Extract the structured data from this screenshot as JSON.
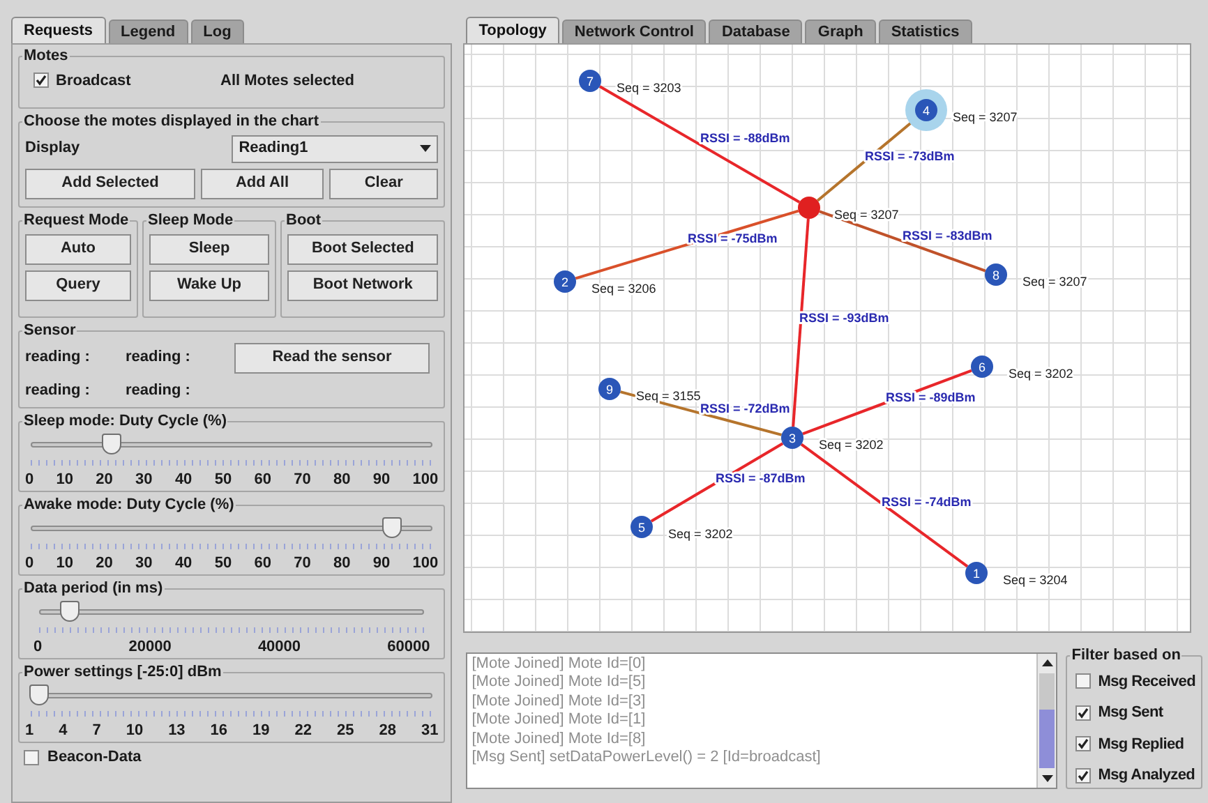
{
  "left_tabs": [
    {
      "label": "Requests",
      "selected": true
    },
    {
      "label": "Legend",
      "selected": false
    },
    {
      "label": "Log",
      "selected": false
    }
  ],
  "motes": {
    "title": "Motes",
    "broadcast": {
      "label": "Broadcast",
      "checked": true
    },
    "status": "All Motes selected"
  },
  "chart_motes": {
    "title": "Choose the motes displayed in the chart",
    "display_label": "Display",
    "display_value": "Reading1",
    "buttons": [
      "Add Selected",
      "Add All",
      "Clear"
    ]
  },
  "mode_groups": [
    {
      "title": "Request Mode",
      "buttons": [
        "Auto",
        "Query"
      ]
    },
    {
      "title": "Sleep Mode",
      "buttons": [
        "Sleep",
        "Wake Up"
      ]
    },
    {
      "title": "Boot",
      "buttons": [
        "Boot Selected",
        "Boot Network"
      ]
    }
  ],
  "sensor": {
    "title": "Sensor",
    "readings": [
      "reading :",
      "reading :",
      "reading :",
      "reading :"
    ],
    "button": "Read the sensor"
  },
  "sliders": [
    {
      "title": "Sleep mode: Duty Cycle (%)",
      "level": 0.2,
      "ticks": [
        "0",
        "10",
        "20",
        "30",
        "40",
        "50",
        "60",
        "70",
        "80",
        "90",
        "100"
      ]
    },
    {
      "title": "Awake mode: Duty Cycle (%)",
      "level": 0.9,
      "ticks": [
        "0",
        "10",
        "20",
        "30",
        "40",
        "50",
        "60",
        "70",
        "80",
        "90",
        "100"
      ]
    },
    {
      "title": "Data period (in ms)",
      "level": 0.08,
      "ticks": [
        "0",
        "20000",
        "40000",
        "60000"
      ]
    },
    {
      "title": "Power settings [-25:0] dBm",
      "level": 0.02,
      "ticks": [
        "1",
        "4",
        "7",
        "10",
        "13",
        "16",
        "19",
        "22",
        "25",
        "28",
        "31"
      ]
    }
  ],
  "beacon": {
    "label": "Beacon-Data",
    "checked": false
  },
  "right_tabs": [
    {
      "label": "Topology",
      "selected": true
    },
    {
      "label": "Network Control",
      "selected": false
    },
    {
      "label": "Database",
      "selected": false
    },
    {
      "label": "Graph",
      "selected": false
    },
    {
      "label": "Statistics",
      "selected": false
    }
  ],
  "topology": {
    "root": {
      "kind": "gateway",
      "seq": "Seq = 3207",
      "selected": false,
      "children": [
        {
          "kind": "mote",
          "label": "7",
          "seq": "Seq = 3203",
          "selected": false,
          "rssi": "RSSI = -88dBm",
          "color": "#e8262a"
        },
        {
          "kind": "mote",
          "label": "4",
          "seq": "Seq = 3207",
          "selected": true,
          "rssi": "RSSI = -73dBm",
          "color": "#b5742c"
        },
        {
          "kind": "mote",
          "label": "2",
          "seq": "Seq = 3206",
          "selected": false,
          "rssi": "RSSI = -75dBm",
          "color": "#d9502a"
        },
        {
          "kind": "mote",
          "label": "8",
          "seq": "Seq = 3207",
          "selected": false,
          "rssi": "RSSI = -83dBm",
          "color": "#c0522a"
        },
        {
          "kind": "mote",
          "label": "3",
          "seq": "Seq = 3202",
          "selected": false,
          "rssi": "RSSI = -93dBm",
          "color": "#e8262a",
          "children": [
            {
              "kind": "mote",
              "label": "9",
              "seq": "Seq = 3155",
              "selected": false,
              "rssi": "RSSI = -72dBm",
              "color": "#b5742c"
            },
            {
              "kind": "mote",
              "label": "6",
              "seq": "Seq = 3202",
              "selected": false,
              "rssi": "RSSI = -89dBm",
              "color": "#e8262a"
            },
            {
              "kind": "mote",
              "label": "5",
              "seq": "Seq = 3202",
              "selected": false,
              "rssi": "RSSI = -87dBm",
              "color": "#e8262a"
            },
            {
              "kind": "mote",
              "label": "1",
              "seq": "Seq = 3204",
              "selected": false,
              "rssi": "RSSI = -74dBm",
              "color": "#e8262a"
            }
          ]
        }
      ]
    }
  },
  "log": {
    "lines": [
      "[Mote Joined] Mote Id=[0]",
      "[Mote Joined] Mote Id=[5]",
      "[Mote Joined] Mote Id=[3]",
      "[Mote Joined] Mote Id=[1]",
      "[Mote Joined] Mote Id=[8]",
      "[Msg Sent] setDataPowerLevel() = 2 [Id=broadcast]"
    ]
  },
  "filter": {
    "title": "Filter based on",
    "options": [
      {
        "label": "Msg Received",
        "checked": false
      },
      {
        "label": "Msg Sent",
        "checked": true
      },
      {
        "label": "Msg Replied",
        "checked": true
      },
      {
        "label": "Msg Analyzed",
        "checked": true
      }
    ]
  }
}
